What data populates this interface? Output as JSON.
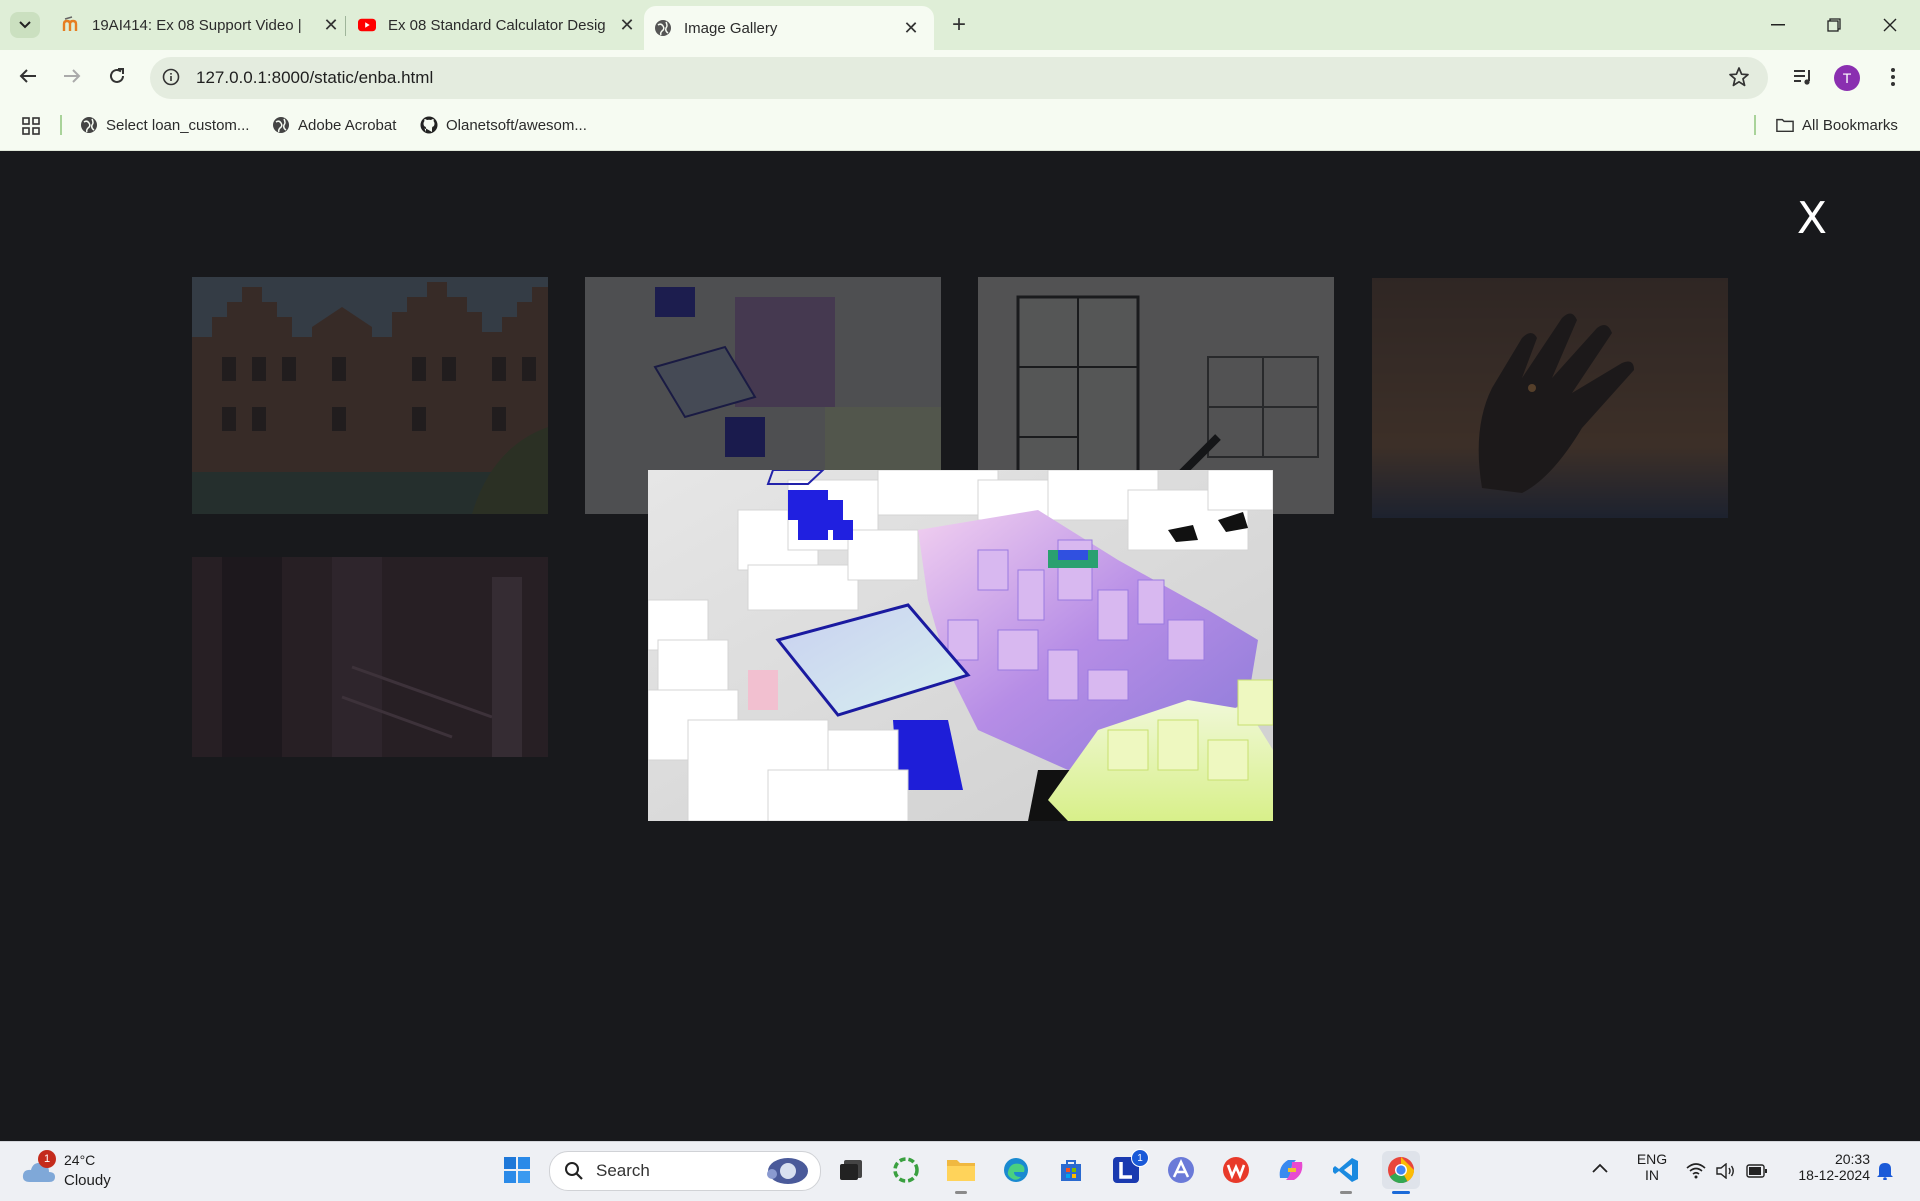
{
  "tabs": [
    {
      "title": "19AI414: Ex 08 Support Video |",
      "favicon": "moodle-icon",
      "active": false
    },
    {
      "title": "Ex 08 Standard Calculator Desig",
      "favicon": "youtube-icon",
      "active": false
    },
    {
      "title": "Image Gallery",
      "favicon": "globe-icon",
      "active": true
    }
  ],
  "toolbar": {
    "url": "127.0.0.1:8000/static/enba.html",
    "profile_initial": "T"
  },
  "bookmarks": [
    {
      "label": "Select loan_custom...",
      "icon": "globe-icon"
    },
    {
      "label": "Adobe Acrobat",
      "icon": "globe-icon"
    },
    {
      "label": "Olanetsoft/awesom...",
      "icon": "github-icon"
    }
  ],
  "all_bookmarks_label": "All Bookmarks",
  "gallery": {
    "close_label": "X",
    "thumbnails": [
      "building-photo",
      "abstract-3d-photo",
      "floorplan-photo",
      "hand-silhouette-photo",
      "dark-interior-photo"
    ],
    "enlarged_image": "abstract-3d-photo"
  },
  "taskbar": {
    "weather": {
      "temp": "24°C",
      "condition": "Cloudy",
      "badge": "1"
    },
    "search_placeholder": "Search",
    "letter_badge": "1",
    "lang_top": "ENG",
    "lang_bottom": "IN",
    "time": "20:33",
    "date": "18-12-2024"
  },
  "colors": {
    "tab_strip": "#dfeed7",
    "toolbar": "#f6fbf2",
    "page_bg": "#18191c",
    "avatar": "#8a2fb0"
  }
}
